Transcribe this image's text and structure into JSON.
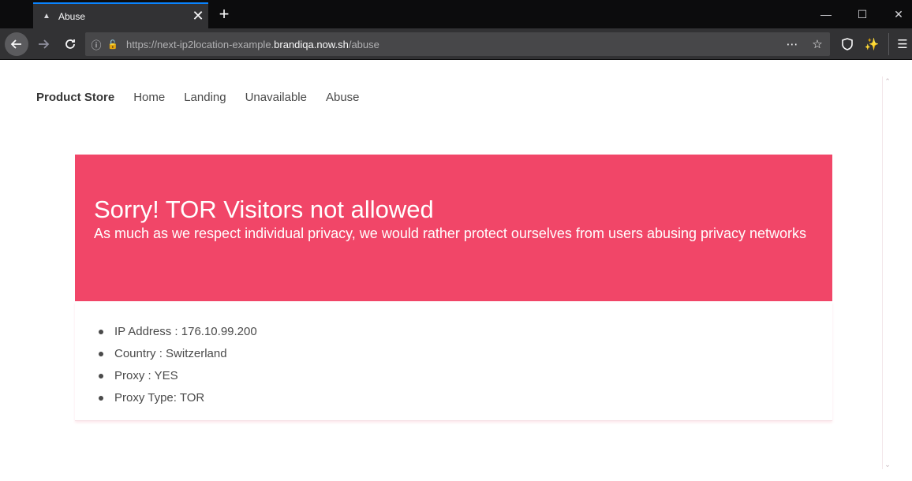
{
  "browser": {
    "tab_title": "Abuse",
    "url_prefix": "https://next-ip2location-example.",
    "url_host": "brandiqa.now.sh",
    "url_path": "/abuse"
  },
  "site_nav": {
    "brand": "Product Store",
    "links": [
      "Home",
      "Landing",
      "Unavailable",
      "Abuse"
    ]
  },
  "hero": {
    "title": "Sorry! TOR Visitors not allowed",
    "subtitle": "As much as we respect individual privacy, we would rather protect ourselves from users abusing privacy networks",
    "color": "#f14668"
  },
  "visitor_info": [
    "IP Address : 176.10.99.200",
    "Country : Switzerland",
    "Proxy : YES",
    "Proxy Type: TOR"
  ],
  "icons": {
    "tab_favicon": "page-icon",
    "back": "arrow-left-icon",
    "forward": "arrow-right-icon",
    "reload": "reload-icon",
    "info": "info-icon",
    "menu": "hamburger-menu-icon"
  }
}
